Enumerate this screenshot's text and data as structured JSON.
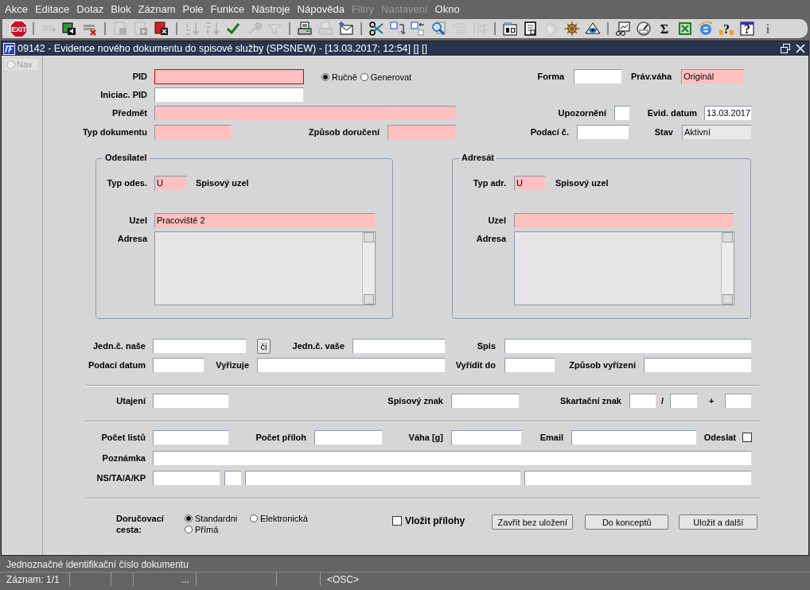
{
  "menu": [
    {
      "label": "Akce",
      "disabled": false
    },
    {
      "label": "Editace",
      "disabled": false
    },
    {
      "label": "Dotaz",
      "disabled": false
    },
    {
      "label": "Blok",
      "disabled": false
    },
    {
      "label": "Záznam",
      "disabled": false
    },
    {
      "label": "Pole",
      "disabled": false
    },
    {
      "label": "Funkce",
      "disabled": false
    },
    {
      "label": "Nástroje",
      "disabled": false
    },
    {
      "label": "Nápověda",
      "disabled": false
    },
    {
      "label": "Filtry",
      "disabled": true
    },
    {
      "label": "Nastavení",
      "disabled": true
    },
    {
      "label": "Okno",
      "disabled": false
    }
  ],
  "toolbar": [
    {
      "kind": "button",
      "glyph": "EXIT",
      "disabled": false
    },
    {
      "kind": "separator"
    },
    {
      "kind": "button",
      "disabled": true
    },
    {
      "kind": "button",
      "disabled": false
    },
    {
      "kind": "button",
      "disabled": false
    },
    {
      "kind": "separator"
    },
    {
      "kind": "button",
      "disabled": true
    },
    {
      "kind": "button",
      "disabled": true
    },
    {
      "kind": "button",
      "disabled": false
    },
    {
      "kind": "separator"
    },
    {
      "kind": "button",
      "disabled": true
    },
    {
      "kind": "button",
      "disabled": true
    },
    {
      "kind": "button",
      "disabled": false
    },
    {
      "kind": "button",
      "disabled": true
    },
    {
      "kind": "button",
      "disabled": true
    },
    {
      "kind": "separator"
    },
    {
      "kind": "button",
      "disabled": false
    },
    {
      "kind": "button",
      "disabled": true
    },
    {
      "kind": "button",
      "disabled": false
    },
    {
      "kind": "separator"
    },
    {
      "kind": "button",
      "disabled": false
    },
    {
      "kind": "button",
      "disabled": false
    },
    {
      "kind": "button",
      "disabled": false
    },
    {
      "kind": "button",
      "disabled": false
    },
    {
      "kind": "button",
      "disabled": true
    },
    {
      "kind": "button",
      "disabled": true
    },
    {
      "kind": "separator"
    },
    {
      "kind": "button",
      "disabled": false
    },
    {
      "kind": "button",
      "disabled": false
    },
    {
      "kind": "button",
      "disabled": true
    },
    {
      "kind": "button",
      "disabled": false
    },
    {
      "kind": "button",
      "disabled": false
    },
    {
      "kind": "separator"
    },
    {
      "kind": "button",
      "disabled": false
    },
    {
      "kind": "button",
      "disabled": false
    },
    {
      "kind": "button",
      "glyph": "Σ",
      "disabled": false
    },
    {
      "kind": "button",
      "disabled": false
    },
    {
      "kind": "button",
      "disabled": false
    },
    {
      "kind": "button",
      "glyph": "?",
      "disabled": false
    },
    {
      "kind": "button",
      "glyph": "?",
      "disabled": false
    },
    {
      "kind": "button",
      "glyph": "i",
      "disabled": true
    }
  ],
  "window": {
    "title": "09142 - Evidence nového dokumentu do spisové služby (SPSNEW) - [13.03.2017; 12:54] [] []"
  },
  "nav": {
    "label": "Nav"
  },
  "form": {
    "fields": [
      {
        "kind": "field",
        "label": "PID",
        "required": true,
        "focused": true
      },
      {
        "kind": "radio",
        "label": "Ručně",
        "selected": true
      },
      {
        "kind": "radio",
        "label": "Generovat",
        "selected": false
      },
      {
        "kind": "field",
        "label": "Forma",
        "required": false,
        "focused": false
      },
      {
        "kind": "field",
        "label": "Práv.váha",
        "value": "Originál",
        "required": true,
        "focused": false
      },
      {
        "kind": "field",
        "label": "Iniciac. PID",
        "required": false,
        "focused": false
      },
      {
        "kind": "field",
        "label": "Předmět",
        "required": true,
        "focused": false
      },
      {
        "kind": "field",
        "label": "Upozornění",
        "required": false,
        "focused": false
      },
      {
        "kind": "field",
        "label": "Evid. datum",
        "value": "13.03.2017",
        "required": false,
        "focused": false
      },
      {
        "kind": "field",
        "label": "Typ dokumentu",
        "required": true,
        "focused": false
      },
      {
        "kind": "field",
        "label": "Způsob doručení",
        "required": true,
        "focused": false
      },
      {
        "kind": "field",
        "label": "Podací č.",
        "required": false,
        "focused": false
      },
      {
        "kind": "display",
        "label": "Stav",
        "value": "Aktivní"
      }
    ]
  },
  "groups": [
    {
      "title": "Odesílatel",
      "rows": [
        [
          {
            "kind": "field",
            "label": "Typ odes.",
            "value": "U",
            "required": true,
            "focused": false
          },
          {
            "kind": "text",
            "label": "Spisový uzel"
          }
        ],
        [
          {
            "kind": "field",
            "label": "Uzel",
            "value": "Pracoviště 2",
            "required": true,
            "focused": false
          }
        ],
        [
          {
            "kind": "textarea",
            "label": "Adresa"
          }
        ]
      ]
    },
    {
      "title": "Adresát",
      "rows": [
        [
          {
            "kind": "field",
            "label": "Typ adr.",
            "value": "U",
            "required": true,
            "focused": false
          },
          {
            "kind": "text",
            "label": "Spisový uzel"
          }
        ],
        [
          {
            "kind": "field",
            "label": "Uzel",
            "required": true,
            "focused": false
          }
        ],
        [
          {
            "kind": "textarea",
            "label": "Adresa"
          }
        ]
      ]
    }
  ],
  "details": {
    "rows": [
      [
        {
          "kind": "field",
          "label": "Jedn.č. naše",
          "required": false,
          "focused": false
        },
        {
          "kind": "button",
          "label": "či"
        },
        {
          "kind": "field",
          "label": "Jedn.č. vaše",
          "required": false,
          "focused": false
        },
        {
          "kind": "field",
          "label": "Spis",
          "required": false,
          "focused": false
        }
      ],
      [
        {
          "kind": "field",
          "label": "Podací datum",
          "required": false,
          "focused": false
        },
        {
          "kind": "field",
          "label": "Vyřizuje",
          "required": false,
          "focused": false
        },
        {
          "kind": "field",
          "label": "Vyřídit do",
          "required": false,
          "focused": false
        },
        {
          "kind": "field",
          "label": "Způsob vyřízení",
          "required": false,
          "focused": false
        }
      ],
      [
        {
          "kind": "field",
          "label": "Utajení",
          "required": false,
          "focused": false
        },
        {
          "kind": "field",
          "label": "Spisový znak",
          "required": false,
          "focused": false
        },
        {
          "kind": "field",
          "label": "Skartační znak",
          "required": false,
          "focused": false
        },
        {
          "kind": "text",
          "label": "/"
        },
        {
          "kind": "field",
          "required": false,
          "focused": false
        },
        {
          "kind": "text",
          "label": "+"
        },
        {
          "kind": "field",
          "required": false,
          "focused": false
        }
      ],
      [
        {
          "kind": "field",
          "label": "Počet listů",
          "required": false,
          "focused": false
        },
        {
          "kind": "field",
          "label": "Počet příloh",
          "required": false,
          "focused": false
        },
        {
          "kind": "field",
          "label": "Váha [g]",
          "required": false,
          "focused": false
        },
        {
          "kind": "field",
          "label": "Email",
          "required": false,
          "focused": false
        },
        {
          "kind": "checkbox",
          "label": "Odeslat",
          "checked": false
        }
      ],
      [
        {
          "kind": "field",
          "label": "Poznámka",
          "required": false,
          "focused": false
        }
      ],
      [
        {
          "kind": "field",
          "label": "NS/TA/A/KP",
          "required": false,
          "focused": false
        },
        {
          "kind": "field",
          "required": false,
          "focused": false
        },
        {
          "kind": "field",
          "required": false,
          "focused": false
        },
        {
          "kind": "field",
          "required": false,
          "focused": false
        }
      ]
    ]
  },
  "delivery": {
    "label": "Doručovací cesta:",
    "options": [
      {
        "label": "Standardni",
        "selected": true
      },
      {
        "label": "Elektronická",
        "selected": false
      },
      {
        "label": "Přímá",
        "selected": false
      }
    ]
  },
  "attachments": {
    "label": "Vložit přílohy",
    "checked": false
  },
  "buttons": [
    "Zavřít bez uložení",
    "Do konceptů",
    "Uložit a další"
  ],
  "status": {
    "message": "Jednoznačné identifikační číslo dokumentu",
    "cells": [
      "Záznam: 1/1",
      "...",
      "<OSC>"
    ]
  }
}
